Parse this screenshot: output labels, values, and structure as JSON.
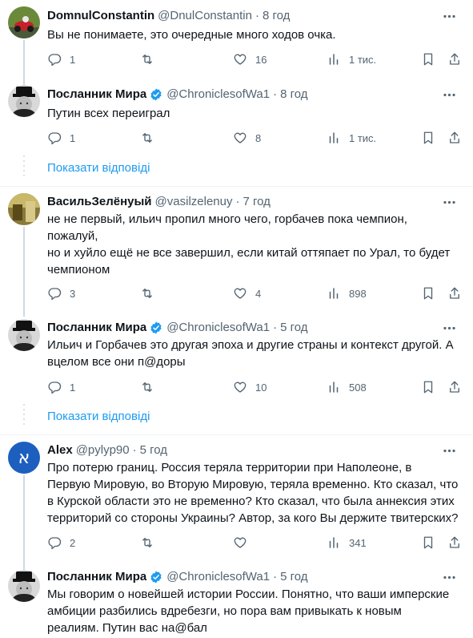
{
  "tweets": [
    {
      "name": "DomnulConstantin",
      "handle": "@DnulConstantin",
      "time": "8 год",
      "verified": false,
      "avatar": "motorcycle-avatar",
      "lines": [
        "Вы не понимаете, это очередные много ходов очка."
      ],
      "replies": "1",
      "retweets": "",
      "likes": "16",
      "views": "1 тис."
    },
    {
      "name": "Посланник Мира",
      "handle": "@ChroniclesofWa1",
      "time": "8 год",
      "verified": true,
      "avatar": "churchill-avatar",
      "lines": [
        "Путин всех переиграл"
      ],
      "replies": "1",
      "retweets": "",
      "likes": "8",
      "views": "1 тис."
    },
    {
      "name": "ВасильЗелёнуый",
      "handle": "@vasilzelenuy",
      "time": "7 год",
      "verified": false,
      "avatar": "landscape-avatar",
      "lines": [
        "не не первый, ильич пропил много чего, горбачев пока чемпион,",
        "пожалуй,",
        "но и хуйло ещё не все завершил, если китай оттяпает по Урал, то будет",
        "чемпионом"
      ],
      "replies": "3",
      "retweets": "",
      "likes": "4",
      "views": "898"
    },
    {
      "name": "Посланник Мира",
      "handle": "@ChroniclesofWa1",
      "time": "5 год",
      "verified": true,
      "avatar": "churchill-avatar",
      "lines": [
        "Ильич и Горбачев это другая эпоха и другие страны и контекст другой. А",
        "вцелом все они п@доры"
      ],
      "replies": "1",
      "retweets": "",
      "likes": "10",
      "views": "508"
    },
    {
      "name": "Alex",
      "handle": "@pylyp90",
      "time": "5 год",
      "verified": false,
      "avatar": "alef-avatar",
      "avatar_glyph": "א",
      "lines": [
        "Про потерю границ. Россия теряла территории при Наполеоне, в",
        "Первую Мировую, во Вторую Мировую, теряла временно. Кто сказал, что",
        "в Курской области это не временно? Кто сказал, что была аннексия этих",
        "территорий со стороны Украины? Автор, за кого Вы держите твитерских?"
      ],
      "replies": "2",
      "retweets": "",
      "likes": "",
      "views": "341"
    },
    {
      "name": "Посланник Мира",
      "handle": "@ChroniclesofWa1",
      "time": "5 год",
      "verified": true,
      "avatar": "churchill-avatar",
      "lines": [
        "Мы говорим о новейшей истории России. Понятно, что ваши имперские",
        "амбиции разбились вдребезги, но пора вам привыкать к новым",
        "реалиям. Путин вас на@бал"
      ]
    }
  ],
  "show_replies_label": "Показати відповіді",
  "colors": {
    "accent": "#1d9bf0",
    "muted": "#536471",
    "text": "#0f1419",
    "line": "#cfd9de"
  }
}
